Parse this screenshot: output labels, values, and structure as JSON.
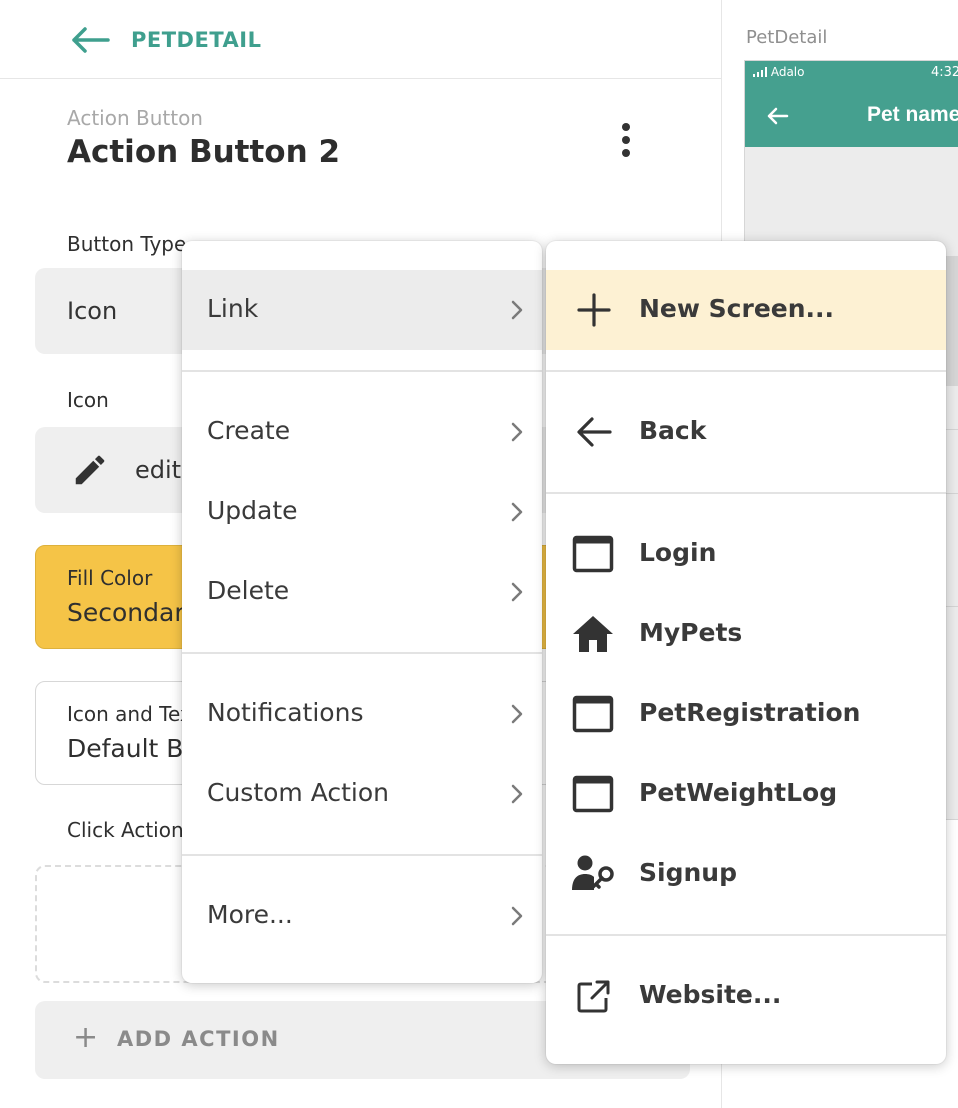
{
  "header": {
    "title": "PETDETAIL"
  },
  "component": {
    "type_label": "Action Button",
    "name": "Action Button 2"
  },
  "fields": {
    "button_type": {
      "label": "Button Type",
      "value": "Icon"
    },
    "icon": {
      "label": "Icon",
      "value": "edit",
      "icon_name": "pencil-icon"
    },
    "fill_color": {
      "label": "Fill Color",
      "value": "Secondary",
      "color": "#f5c447"
    },
    "icon_text": {
      "label": "Icon and Text Color",
      "value": "Default Bl"
    },
    "click_actions": {
      "label": "Click Actions"
    }
  },
  "add_action": {
    "label": "ADD ACTION"
  },
  "preview": {
    "screen_label": "PetDetail",
    "carrier": "Adalo",
    "time": "4:32",
    "header_title": "Pet name's",
    "theme_color": "#45a08f"
  },
  "action_menu": {
    "groups": [
      [
        {
          "label": "Link"
        }
      ],
      [
        {
          "label": "Create"
        },
        {
          "label": "Update"
        },
        {
          "label": "Delete"
        }
      ],
      [
        {
          "label": "Notifications"
        },
        {
          "label": "Custom Action"
        }
      ],
      [
        {
          "label": "More..."
        }
      ]
    ]
  },
  "link_submenu": {
    "new_screen": {
      "label": "New Screen...",
      "icon": "plus-icon"
    },
    "back": {
      "label": "Back",
      "icon": "arrow-left-icon"
    },
    "screens": [
      {
        "label": "Login",
        "icon": "window-icon"
      },
      {
        "label": "MyPets",
        "icon": "home-icon"
      },
      {
        "label": "PetRegistration",
        "icon": "window-icon"
      },
      {
        "label": "PetWeightLog",
        "icon": "window-icon"
      },
      {
        "label": "Signup",
        "icon": "user-key-icon"
      }
    ],
    "website": {
      "label": "Website...",
      "icon": "external-link-icon"
    }
  }
}
